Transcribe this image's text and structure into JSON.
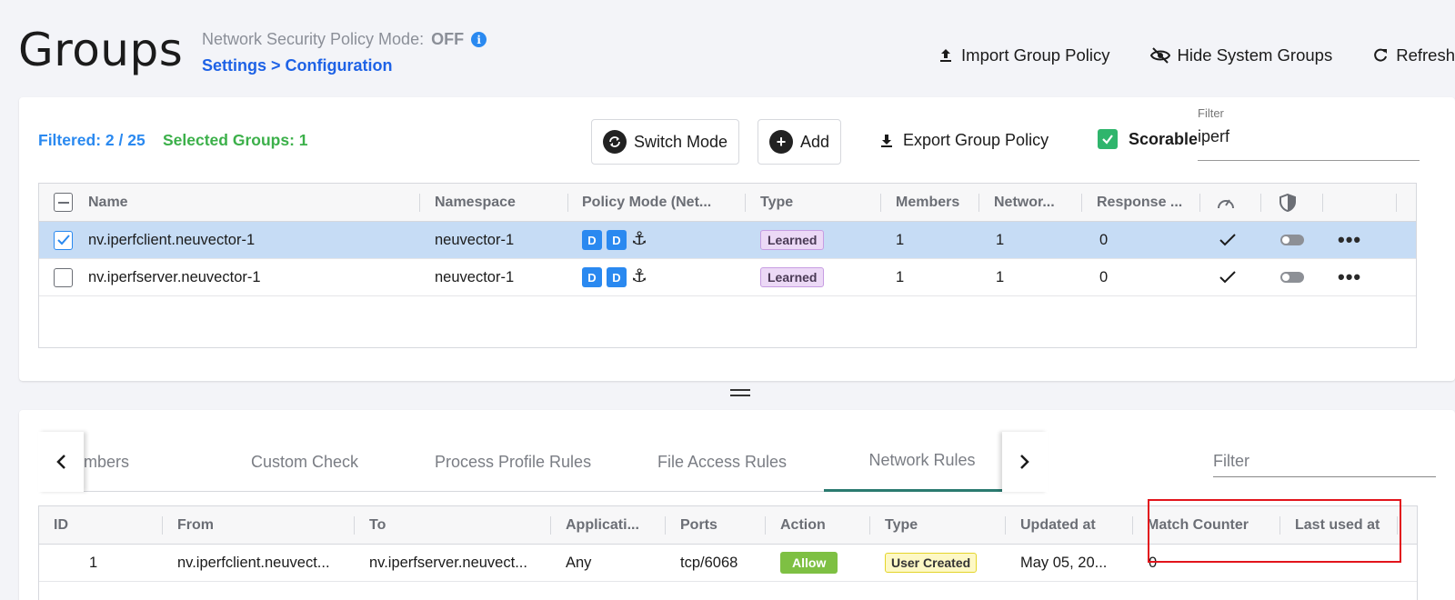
{
  "header": {
    "title": "Groups",
    "policy_mode_label": "Network Security Policy Mode:",
    "policy_mode_value": "OFF",
    "breadcrumb": "Settings > Configuration",
    "actions": {
      "import": "Import Group Policy",
      "hide": "Hide System Groups",
      "refresh": "Refresh"
    }
  },
  "toolbar": {
    "filtered": "Filtered: 2 / 25",
    "selected": "Selected Groups:  1",
    "switch_mode": "Switch Mode",
    "add": "Add",
    "export": "Export Group Policy",
    "scorable": "Scorable",
    "filter_label": "Filter",
    "filter_value": "iperf"
  },
  "groups_table": {
    "columns": [
      "Name",
      "Namespace",
      "Policy Mode (Net...",
      "Type",
      "Members",
      "Networ...",
      "Response ..."
    ],
    "rows": [
      {
        "name": "nv.iperfclient.neuvector-1",
        "namespace": "neuvector-1",
        "mode1": "D",
        "mode2": "D",
        "type": "Learned",
        "members": "1",
        "network": "1",
        "response": "0",
        "selected": true
      },
      {
        "name": "nv.iperfserver.neuvector-1",
        "namespace": "neuvector-1",
        "mode1": "D",
        "mode2": "D",
        "type": "Learned",
        "members": "1",
        "network": "1",
        "response": "0",
        "selected": false
      }
    ]
  },
  "tabs": {
    "items": [
      "mbers",
      "Custom Check",
      "Process Profile Rules",
      "File Access Rules",
      "Network Rules"
    ],
    "active": "Network Rules",
    "filter_placeholder": "Filter"
  },
  "rules_table": {
    "columns": [
      "ID",
      "From",
      "To",
      "Applicati...",
      "Ports",
      "Action",
      "Type",
      "Updated at",
      "Match Counter",
      "Last used at"
    ],
    "rows": [
      {
        "id": "1",
        "from": "nv.iperfclient.neuvect...",
        "to": "nv.iperfserver.neuvect...",
        "application": "Any",
        "ports": "tcp/6068",
        "action": "Allow",
        "type": "User Created",
        "updated": "May 05, 20...",
        "match_counter": "0",
        "last_used": ""
      }
    ]
  },
  "colors": {
    "accent_blue": "#2a89f0",
    "link_blue": "#1e62e6",
    "green": "#3cb04a",
    "selected_row": "#c6dcf5",
    "highlight_red": "#e2141c"
  }
}
